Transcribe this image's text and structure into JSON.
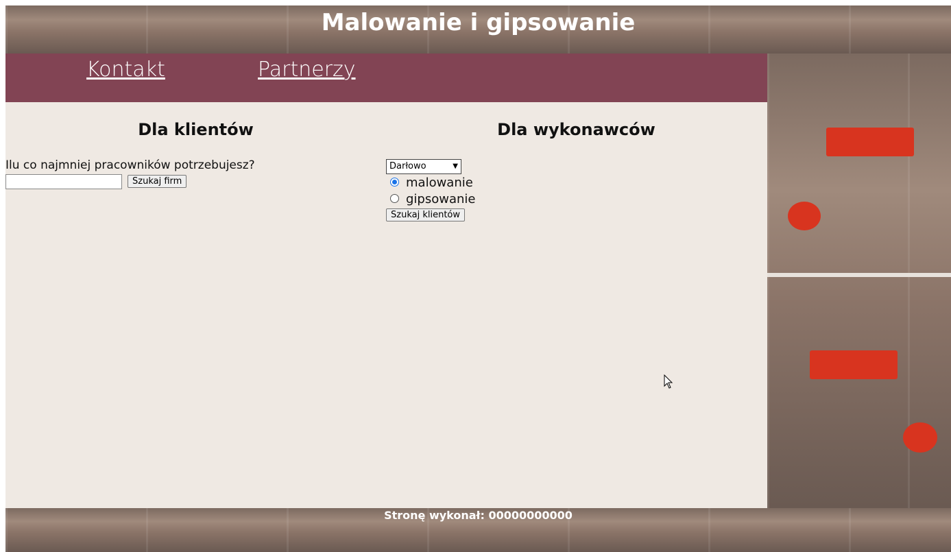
{
  "header": {
    "title": "Malowanie i gipsowanie"
  },
  "nav": {
    "links": [
      "Kontakt",
      "Partnerzy"
    ]
  },
  "clients": {
    "heading": "Dla klientów",
    "question": "Ilu co najmniej pracowników potrzebujesz?",
    "input_value": "",
    "button": "Szukaj firm"
  },
  "contractors": {
    "heading": "Dla wykonawców",
    "select_value": "Darłowo",
    "radios": [
      {
        "label": "malowanie",
        "checked": true
      },
      {
        "label": "gipsowanie",
        "checked": false
      }
    ],
    "button": "Szukaj klientów"
  },
  "footer": {
    "text": "Stronę wykonał: 00000000000"
  },
  "colors": {
    "nav_bg": "#824454",
    "main_bg": "#efe9e3",
    "accent_red": "#d8341f",
    "radio_blue": "#1a73e8"
  }
}
